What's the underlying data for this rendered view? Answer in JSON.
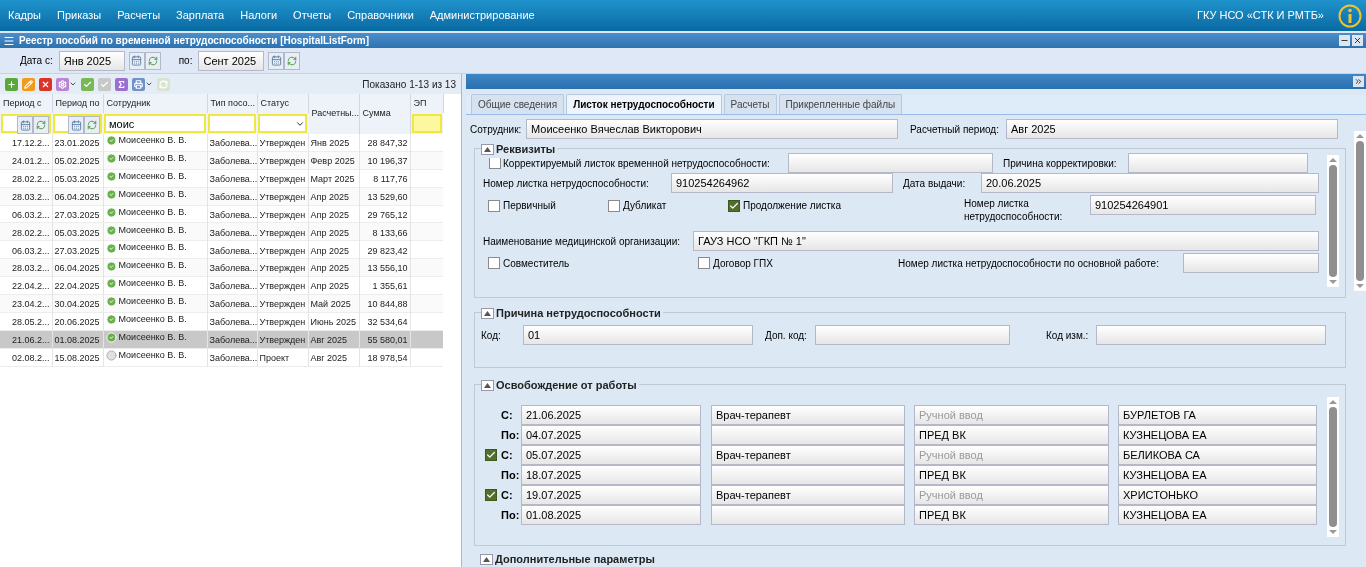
{
  "menu": {
    "items": [
      "Кадры",
      "Приказы",
      "Расчеты",
      "Зарплата",
      "Налоги",
      "Отчеты",
      "Справочники",
      "Администрирование"
    ],
    "org": "ГКУ НСО «СТК И РМТБ»"
  },
  "window": {
    "title": "Реестр пособий по временной нетрудоспособности [HospitalListForm]"
  },
  "period_filter": {
    "from_label": "Дата с:",
    "from": "Янв 2025",
    "to_label": "по:",
    "to": "Сент 2025"
  },
  "list": {
    "shown": "Показано 1-13 из 13",
    "columns": [
      {
        "label": "Период с",
        "kind": "date"
      },
      {
        "label": "Период по",
        "kind": "date"
      },
      {
        "label": "Сотрудник",
        "kind": "text",
        "value": "моис"
      },
      {
        "label": "Тип посо...",
        "kind": "text"
      },
      {
        "label": "Статус",
        "kind": "select"
      },
      {
        "label": "Расчетны...",
        "kind": "none"
      },
      {
        "label": "Сумма",
        "kind": "none"
      },
      {
        "label": "ЭП",
        "kind": "highlight"
      }
    ],
    "rows": [
      {
        "cells": [
          "17.12.2...",
          "23.01.2025",
          "Моисеенко В. В.",
          "Заболева...",
          "Утвержден",
          "Янв 2025",
          "28 847,32"
        ],
        "kind": "approved",
        "selected": false
      },
      {
        "cells": [
          "24.01.2...",
          "05.02.2025",
          "Моисеенко В. В.",
          "Заболева...",
          "Утвержден",
          "Февр 2025",
          "10 196,37"
        ],
        "kind": "approved",
        "selected": false
      },
      {
        "cells": [
          "28.02.2...",
          "05.03.2025",
          "Моисеенко В. В.",
          "Заболева...",
          "Утвержден",
          "Март 2025",
          "8 117,76"
        ],
        "kind": "approved",
        "selected": false
      },
      {
        "cells": [
          "28.03.2...",
          "06.04.2025",
          "Моисеенко В. В.",
          "Заболева...",
          "Утвержден",
          "Апр 2025",
          "13 529,60"
        ],
        "kind": "approved",
        "selected": false
      },
      {
        "cells": [
          "06.03.2...",
          "27.03.2025",
          "Моисеенко В. В.",
          "Заболева...",
          "Утвержден",
          "Апр 2025",
          "29 765,12"
        ],
        "kind": "approved",
        "selected": false
      },
      {
        "cells": [
          "28.02.2...",
          "05.03.2025",
          "Моисеенко В. В.",
          "Заболева...",
          "Утвержден",
          "Апр 2025",
          "8 133,66"
        ],
        "kind": "approved",
        "selected": false
      },
      {
        "cells": [
          "06.03.2...",
          "27.03.2025",
          "Моисеенко В. В.",
          "Заболева...",
          "Утвержден",
          "Апр 2025",
          "29 823,42"
        ],
        "kind": "approved",
        "selected": false
      },
      {
        "cells": [
          "28.03.2...",
          "06.04.2025",
          "Моисеенко В. В.",
          "Заболева...",
          "Утвержден",
          "Апр 2025",
          "13 556,10"
        ],
        "kind": "approved",
        "selected": false
      },
      {
        "cells": [
          "22.04.2...",
          "22.04.2025",
          "Моисеенко В. В.",
          "Заболева...",
          "Утвержден",
          "Апр 2025",
          "1 355,61"
        ],
        "kind": "approved",
        "selected": false
      },
      {
        "cells": [
          "23.04.2...",
          "30.04.2025",
          "Моисеенко В. В.",
          "Заболева...",
          "Утвержден",
          "Май 2025",
          "10 844,88"
        ],
        "kind": "approved",
        "selected": false
      },
      {
        "cells": [
          "28.05.2...",
          "20.06.2025",
          "Моисеенко В. В.",
          "Заболева...",
          "Утвержден",
          "Июнь 2025",
          "32 534,64"
        ],
        "kind": "approved",
        "selected": false
      },
      {
        "cells": [
          "21.06.2...",
          "01.08.2025",
          "Моисеенко В. В.",
          "Заболева...",
          "Утвержден",
          "Авг 2025",
          "55 580,01"
        ],
        "kind": "approved",
        "selected": true
      },
      {
        "cells": [
          "02.08.2...",
          "15.08.2025",
          "Моисеенко В. В.",
          "Заболева...",
          "Проект",
          "Авг 2025",
          "18 978,54"
        ],
        "kind": "draft",
        "selected": false
      }
    ]
  },
  "tabs": [
    {
      "label": "Общие сведения",
      "selected": false
    },
    {
      "label": "Листок нетрудоспособности",
      "selected": true
    },
    {
      "label": "Расчеты",
      "selected": false
    },
    {
      "label": "Прикрепленные файлы",
      "selected": false
    }
  ],
  "employee": {
    "label": "Сотрудник:",
    "value": "Моисеенко Вячеслав Викторович"
  },
  "calc_period": {
    "label": "Расчетный период:",
    "value": "Авг 2025"
  },
  "requisites": {
    "title": "Реквизиты",
    "expanded": true,
    "corrected": {
      "label": "Корректируемый листок временной нетрудоспособности:",
      "checked": false
    },
    "correction_reason_label": "Причина корректировки:",
    "sheet_number": {
      "label": "Номер листка нетрудоспособности:",
      "value": "910254264962"
    },
    "issue_date": {
      "label": "Дата выдачи:",
      "value": "20.06.2025"
    },
    "flags": [
      {
        "label": "Первичный",
        "checked": false
      },
      {
        "label": "Дубликат",
        "checked": false
      },
      {
        "label": "Продолжение листка",
        "checked": true
      }
    ],
    "previous_number": {
      "label": "Номер листка нетрудоспособности:",
      "value": "910254264901"
    },
    "organization": {
      "label": "Наименование медицинской организации:",
      "value": "ГАУЗ НСО \"ГКП № 1\""
    },
    "flags2": [
      {
        "label": "Совместитель",
        "checked": false
      },
      {
        "label": "Договор ГПХ",
        "checked": false
      }
    ],
    "main_job_number": {
      "label": "Номер листка нетрудоспособности по основной работе:"
    }
  },
  "reason": {
    "title": "Причина нетрудоспособности",
    "expanded": true,
    "code": {
      "label": "Код:",
      "value": "01"
    },
    "extra_code": {
      "label": "Доп. код:"
    },
    "change_code": {
      "label": "Код изм.:"
    }
  },
  "release": {
    "title": "Освобождение от работы",
    "expanded": true,
    "periods": [
      {
        "kind": "plain",
        "from": {
          "label": "С:",
          "date": "21.06.2025",
          "position": "Врач-терапевт",
          "role_placeholder": "Ручной ввод",
          "name": "БУРЛЕТОВ ГА"
        },
        "to": {
          "label": "По:",
          "date": "04.07.2025",
          "role": "ПРЕД ВК",
          "name": "КУЗНЕЦОВА ЕА"
        }
      },
      {
        "kind": "check",
        "checked": true,
        "from": {
          "label": "С:",
          "date": "05.07.2025",
          "position": "Врач-терапевт",
          "role_placeholder": "Ручной ввод",
          "name": "БЕЛИКОВА СА"
        },
        "to": {
          "label": "По:",
          "date": "18.07.2025",
          "role": "ПРЕД ВК",
          "name": "КУЗНЕЦОВА ЕА"
        }
      },
      {
        "kind": "check",
        "checked": true,
        "from": {
          "label": "С:",
          "date": "19.07.2025",
          "position": "Врач-терапевт",
          "role_placeholder": "Ручной ввод",
          "name": "ХРИСТОНЬКО"
        },
        "to": {
          "label": "По:",
          "date": "01.08.2025",
          "role": "ПРЕД ВК",
          "name": "КУЗНЕЦОВА ЕА"
        }
      }
    ]
  },
  "extra": {
    "title": "Дополнительные параметры",
    "expanded": true
  }
}
